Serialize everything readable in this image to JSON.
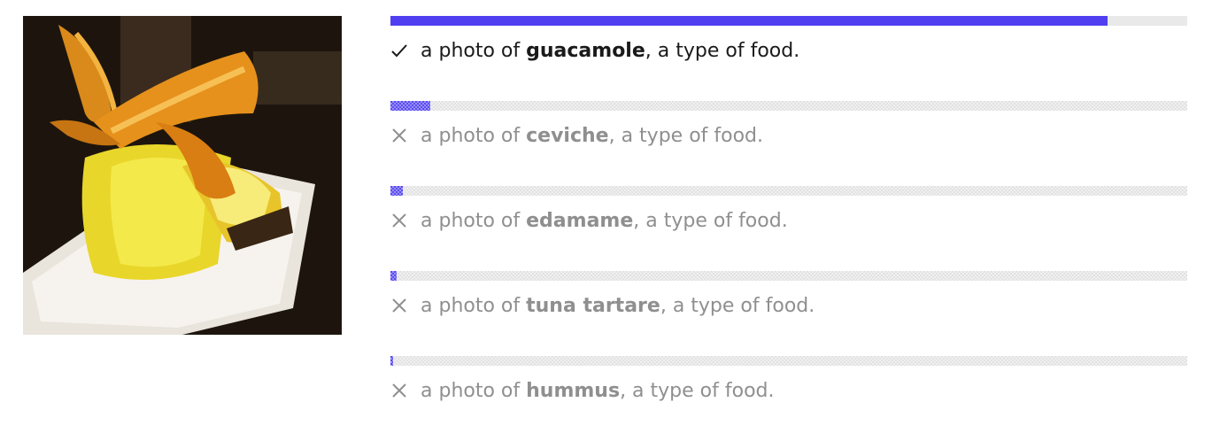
{
  "image": {
    "description_icon": "food-photo"
  },
  "prediction": {
    "prefix": "a photo of ",
    "suffix": ", a type of food.",
    "bar_color": "#4f3ff0",
    "items": [
      {
        "label": "guacamole",
        "score": 0.9,
        "correct": true
      },
      {
        "label": "ceviche",
        "score": 0.05,
        "correct": false
      },
      {
        "label": "edamame",
        "score": 0.016,
        "correct": false
      },
      {
        "label": "tuna tartare",
        "score": 0.008,
        "correct": false
      },
      {
        "label": "hummus",
        "score": 0.003,
        "correct": false
      }
    ]
  }
}
